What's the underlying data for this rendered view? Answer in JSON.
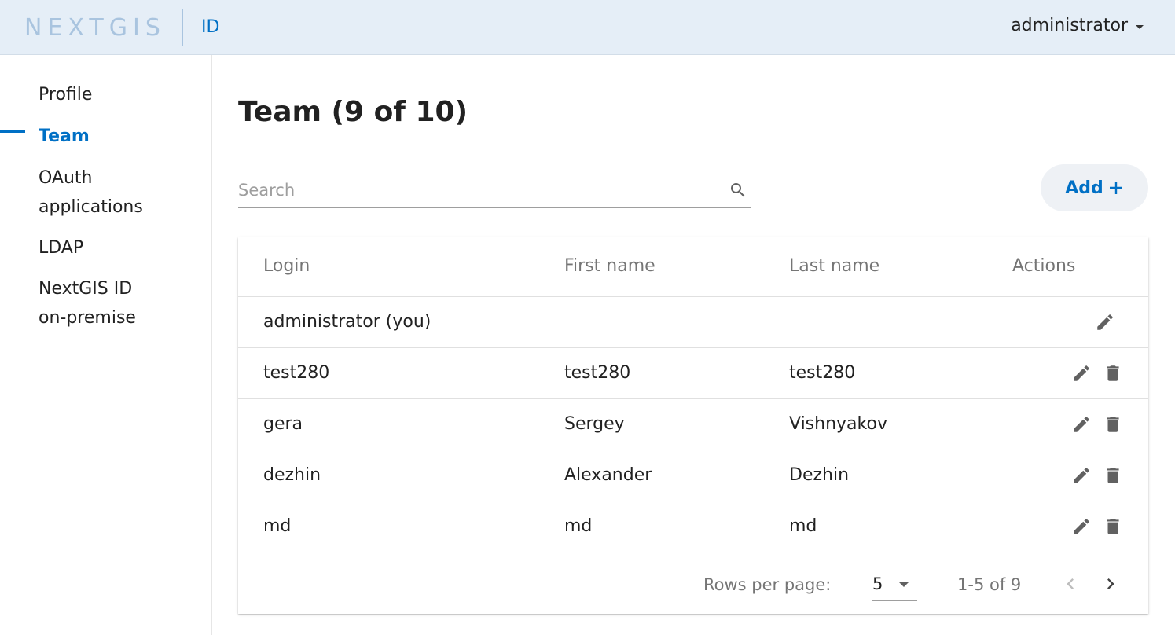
{
  "header": {
    "logo_text": "NEXTGIS",
    "product": "ID",
    "user": "administrator"
  },
  "sidebar": {
    "items": [
      {
        "label": "Profile",
        "active": false
      },
      {
        "label": "Team",
        "active": true
      },
      {
        "label": "OAuth applications",
        "active": false
      },
      {
        "label": "LDAP",
        "active": false
      },
      {
        "label": "NextGIS ID on-premise",
        "active": false
      }
    ]
  },
  "main": {
    "title": "Team (9 of 10)",
    "search": {
      "placeholder": "Search",
      "value": ""
    },
    "add_label": "Add"
  },
  "table": {
    "columns": [
      "Login",
      "First name",
      "Last name",
      "Actions"
    ],
    "rows": [
      {
        "login": "administrator (you)",
        "first": "",
        "last": "",
        "actions": [
          "edit"
        ]
      },
      {
        "login": "test280",
        "first": "test280",
        "last": "test280",
        "actions": [
          "edit",
          "delete"
        ]
      },
      {
        "login": "gera",
        "first": "Sergey",
        "last": "Vishnyakov",
        "actions": [
          "edit",
          "delete"
        ]
      },
      {
        "login": "dezhin",
        "first": "Alexander",
        "last": "Dezhin",
        "actions": [
          "edit",
          "delete"
        ]
      },
      {
        "login": "md",
        "first": "md",
        "last": "md",
        "actions": [
          "edit",
          "delete"
        ]
      }
    ],
    "pagination": {
      "rows_per_page_label": "Rows per page:",
      "rows_per_page": "5",
      "range": "1-5 of 9"
    }
  },
  "colors": {
    "accent": "#0070c5",
    "header_bg": "#e5eef7",
    "logo": "#a9c4df"
  },
  "icons": {
    "search": "search-icon",
    "add": "plus-icon",
    "edit": "pencil-icon",
    "delete": "trash-icon",
    "prev": "chevron-left-icon",
    "next": "chevron-right-icon",
    "dropdown": "caret-down-icon"
  }
}
